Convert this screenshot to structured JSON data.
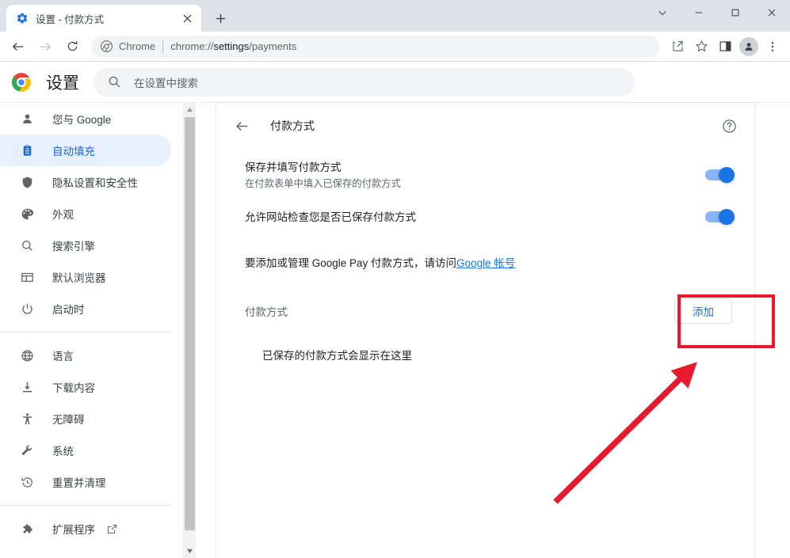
{
  "window": {
    "controls": [
      {
        "name": "minimize-all-chevron",
        "glyph": "chevron-down-icon"
      },
      {
        "name": "minimize",
        "glyph": "minimize-icon"
      },
      {
        "name": "maximize",
        "glyph": "maximize-icon"
      },
      {
        "name": "close",
        "glyph": "close-icon"
      }
    ]
  },
  "tab": {
    "title": "设置 - 付款方式",
    "favicon": "settings-gear-icon",
    "close_icon": "close-icon",
    "new_tab_icon": "plus-icon"
  },
  "toolbar": {
    "back_icon": "back-arrow-icon",
    "forward_icon": "forward-arrow-icon",
    "reload_icon": "reload-icon",
    "omnibox": {
      "site_icon": "chrome-logo-icon",
      "site_label": "Chrome",
      "url_prefix": "chrome://",
      "url_bold": "settings",
      "url_suffix": "/payments"
    },
    "share_icon": "share-icon",
    "bookmark_icon": "star-icon",
    "side_panel_icon": "side-panel-icon",
    "profile_icon": "avatar-icon",
    "menu_icon": "three-dot-menu-icon"
  },
  "settings_header": {
    "logo": "chrome-logo-icon",
    "title": "设置",
    "search": {
      "icon": "search-icon",
      "placeholder": "在设置中搜索",
      "value": ""
    }
  },
  "sidebar": {
    "items": [
      {
        "label": "您与 Google",
        "icon": "person-icon",
        "active": false
      },
      {
        "label": "自动填充",
        "icon": "clipboard-icon",
        "active": true
      },
      {
        "label": "隐私设置和安全性",
        "icon": "shield-icon",
        "active": false
      },
      {
        "label": "外观",
        "icon": "palette-icon",
        "active": false
      },
      {
        "label": "搜索引擎",
        "icon": "search-icon",
        "active": false
      },
      {
        "label": "默认浏览器",
        "icon": "browser-window-icon",
        "active": false
      },
      {
        "label": "启动时",
        "icon": "power-icon",
        "active": false
      }
    ],
    "items2": [
      {
        "label": "语言",
        "icon": "globe-icon",
        "active": false
      },
      {
        "label": "下载内容",
        "icon": "download-icon",
        "active": false
      },
      {
        "label": "无障碍",
        "icon": "accessibility-icon",
        "active": false
      },
      {
        "label": "系统",
        "icon": "wrench-icon",
        "active": false
      },
      {
        "label": "重置并清理",
        "icon": "restore-history-icon",
        "active": false
      }
    ],
    "items3": [
      {
        "label": "扩展程序",
        "icon": "puzzle-icon",
        "external_icon": "external-link-icon",
        "active": false
      }
    ]
  },
  "content": {
    "back_icon": "back-arrow-icon",
    "title": "付款方式",
    "help_icon": "help-circle-icon",
    "rows": [
      {
        "title": "保存并填写付款方式",
        "subtitle": "在付款表单中填入已保存的付款方式",
        "toggle_on": true
      },
      {
        "title": "允许网站检查您是否已保存付款方式",
        "subtitle": "",
        "toggle_on": true
      }
    ],
    "info": {
      "text_before": "要添加或管理 Google Pay 付款方式，请访问 ",
      "link_text": "Google 帐号"
    },
    "section": {
      "title": "付款方式",
      "add_button": "添加"
    },
    "empty_text": "已保存的付款方式会显示在这里"
  },
  "annotation": {
    "highlight_color": "#e8192c",
    "arrow_color": "#e8192c",
    "target": "add-payment-method-button"
  }
}
